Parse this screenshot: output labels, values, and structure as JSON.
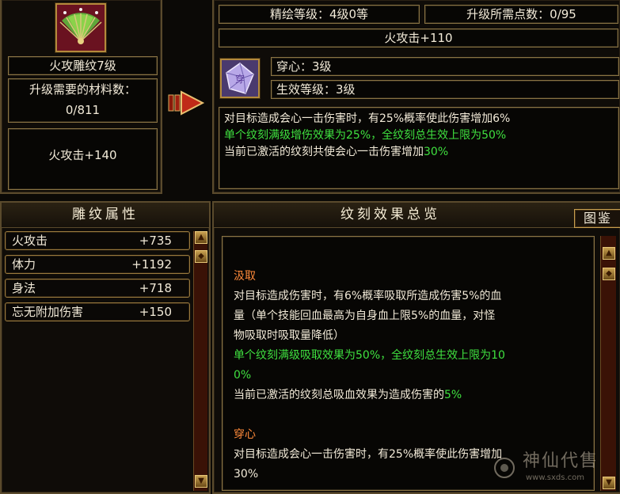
{
  "left_top": {
    "item_name": "火攻雕纹7级",
    "material_label": "升级需要的材料数：",
    "material_value": "0/811",
    "item_effect": "火攻击+140"
  },
  "right_top": {
    "refine_level": "精绘等级：4级0等",
    "upgrade_points": "升级所需点数：0/95",
    "upgrade_effect": "火攻击+110",
    "skill_name": "穿心：3级",
    "effective_level": "生效等级：3级",
    "desc_line1": "对目标造成会心一击伤害时，有25%概率使此伤害增加6%",
    "desc_line2": "单个纹刻满级增伤效果为25%，全纹刻总生效上限为50%",
    "desc_line3_prefix": "当前已激活的纹刻共使会心一击伤害增加",
    "desc_line3_value": "30%"
  },
  "attr_panel": {
    "title": "雕纹属性",
    "stats": [
      {
        "name": "火攻击",
        "value": "+735"
      },
      {
        "name": "体力",
        "value": "+1192"
      },
      {
        "name": "身法",
        "value": "+718"
      },
      {
        "name": "忘无附加伤害",
        "value": "+150"
      }
    ]
  },
  "overview_panel": {
    "title": "纹刻效果总览",
    "tujian_button": "图鉴",
    "entries": [
      {
        "name": "汲取",
        "lines": [
          {
            "text": "对目标造成伤害时，有6%概率吸取所造成伤害5%的血",
            "color": "white"
          },
          {
            "text": "量（单个技能回血最高为自身血上限5%的血量，对怪",
            "color": "white"
          },
          {
            "text": "物吸取时吸取量降低）",
            "color": "white"
          },
          {
            "text": "单个纹刻满级吸取效果为50%，全纹刻总生效上限为10",
            "color": "green"
          },
          {
            "text": "0%",
            "color": "green"
          }
        ],
        "active_prefix": "当前已激活的纹刻总吸血效果为造成伤害的",
        "active_value": "5%"
      },
      {
        "name": "穿心",
        "lines": [
          {
            "text": "对目标造成会心一击伤害时，有25%概率使此伤害增加",
            "color": "white"
          },
          {
            "text": "30%",
            "color": "white"
          }
        ]
      }
    ]
  },
  "watermark": {
    "title": "神仙代售",
    "url": "www.sxds.com"
  },
  "colors": {
    "accent_gold": "#b48a3c",
    "effect_green": "#3fe03f",
    "title_orange": "#ff8a3a",
    "scroll_red": "#3a1206"
  }
}
